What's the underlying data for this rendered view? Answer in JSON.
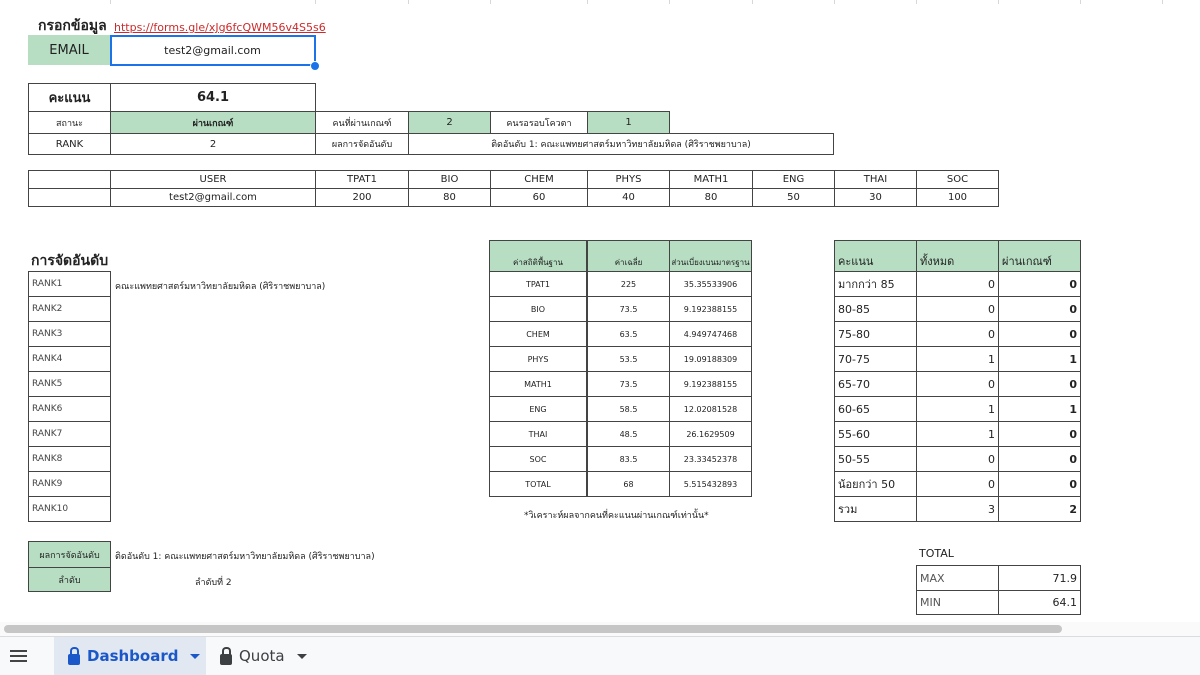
{
  "header": {
    "title": "กรอกข้อมูล",
    "form_link": "https://forms.gle/xJg6fcQWM56v4S5s6",
    "email_label": "EMAIL",
    "email_value": "test2@gmail.com"
  },
  "summary": {
    "score_label": "คะแนน",
    "score_value": "64.1",
    "status_label": "สถานะ",
    "status_value": "ผ่านเกณฑ์",
    "passers_label": "คนที่ผ่านเกณฑ์",
    "passers_value": "2",
    "waiting_label": "คนรอรอบโควตา",
    "waiting_value": "1",
    "rank_label": "RANK",
    "rank_value": "2",
    "result_label": "ผลการจัดอันดับ",
    "result_value": "ติดอันดับ 1: คณะแพทยศาสตร์มหาวิทยาลัยมหิดล (ศิริราชพยาบาล)"
  },
  "scores": {
    "headers": [
      "USER",
      "TPAT1",
      "BIO",
      "CHEM",
      "PHYS",
      "MATH1",
      "ENG",
      "THAI",
      "SOC"
    ],
    "row": [
      "test2@gmail.com",
      "200",
      "80",
      "60",
      "40",
      "80",
      "50",
      "30",
      "100"
    ]
  },
  "ranking": {
    "title": "การจัดอันดับ",
    "items": [
      {
        "label": "RANK1",
        "value": "คณะแพทยศาสตร์มหาวิทยาลัยมหิดล (ศิริราชพยาบาล)"
      },
      {
        "label": "RANK2",
        "value": ""
      },
      {
        "label": "RANK3",
        "value": ""
      },
      {
        "label": "RANK4",
        "value": ""
      },
      {
        "label": "RANK5",
        "value": ""
      },
      {
        "label": "RANK6",
        "value": ""
      },
      {
        "label": "RANK7",
        "value": ""
      },
      {
        "label": "RANK8",
        "value": ""
      },
      {
        "label": "RANK9",
        "value": ""
      },
      {
        "label": "RANK10",
        "value": ""
      }
    ],
    "result_label": "ผลการจัดอันดับ",
    "result_value": "ติดอันดับ 1: คณะแพทยศาสตร์มหาวิทยาลัยมหิดล (ศิริราชพยาบาล)",
    "order_label": "ลำดับ",
    "order_value": "ลำดับที่ 2"
  },
  "stats": {
    "headers": [
      "ค่าสถิติพื้นฐาน",
      "ค่าเฉลี่ย",
      "ส่วนเบี่ยงเบนมาตรฐาน"
    ],
    "rows": [
      [
        "TPAT1",
        "225",
        "35.35533906"
      ],
      [
        "BIO",
        "73.5",
        "9.192388155"
      ],
      [
        "CHEM",
        "63.5",
        "4.949747468"
      ],
      [
        "PHYS",
        "53.5",
        "19.09188309"
      ],
      [
        "MATH1",
        "73.5",
        "9.192388155"
      ],
      [
        "ENG",
        "58.5",
        "12.02081528"
      ],
      [
        "THAI",
        "48.5",
        "26.1629509"
      ],
      [
        "SOC",
        "83.5",
        "23.33452378"
      ],
      [
        "TOTAL",
        "68",
        "5.515432893"
      ]
    ],
    "note": "*วิเคราะห์ผลจากคนที่คะแนนผ่านเกณฑ์เท่านั้น*"
  },
  "distribution": {
    "headers": [
      "คะแนน",
      "ทั้งหมด",
      "ผ่านเกณฑ์"
    ],
    "rows": [
      [
        "มากกว่า 85",
        "0",
        "0"
      ],
      [
        "80-85",
        "0",
        "0"
      ],
      [
        "75-80",
        "0",
        "0"
      ],
      [
        "70-75",
        "1",
        "1"
      ],
      [
        "65-70",
        "0",
        "0"
      ],
      [
        "60-65",
        "1",
        "1"
      ],
      [
        "55-60",
        "1",
        "0"
      ],
      [
        "50-55",
        "0",
        "0"
      ],
      [
        "น้อยกว่า 50",
        "0",
        "0"
      ],
      [
        "รวม",
        "3",
        "2"
      ]
    ]
  },
  "total": {
    "title": "TOTAL",
    "max_label": "MAX",
    "max_value": "71.9",
    "min_label": "MIN",
    "min_value": "64.1"
  },
  "tabs": {
    "menu_icon": "hamburger-menu-icon",
    "items": [
      {
        "label": "Dashboard",
        "icon": "lock-icon",
        "active": true
      },
      {
        "label": "Quota",
        "icon": "lock-icon",
        "active": false
      }
    ]
  },
  "colors": {
    "header_green": "#b7dec3",
    "link_red": "#cc2b2b",
    "active_tab_blue": "#1a57c8"
  }
}
